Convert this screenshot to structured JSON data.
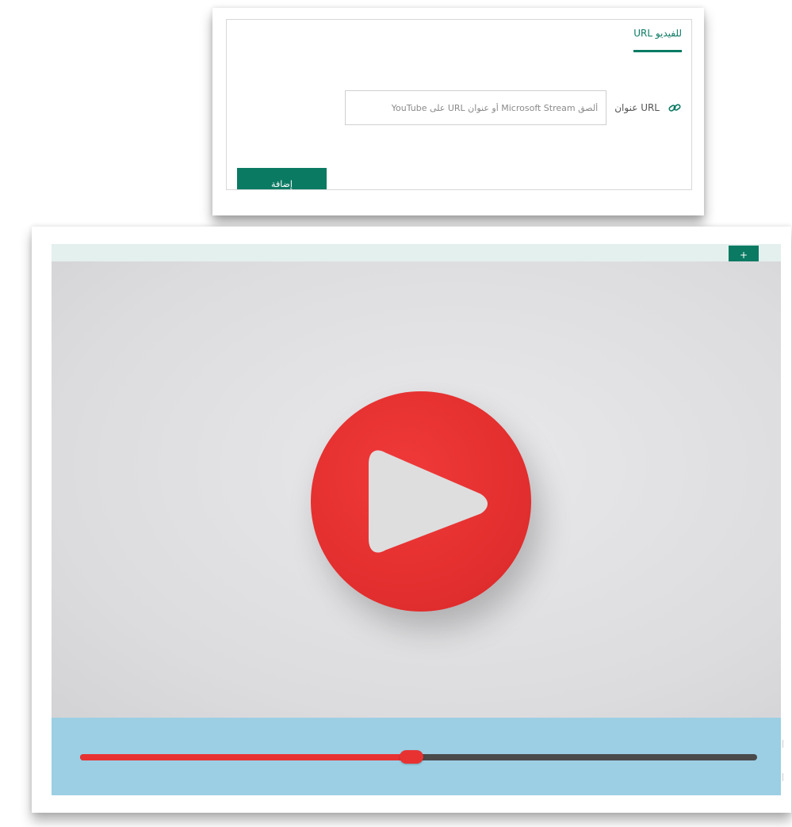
{
  "dialog": {
    "tab_label": "URL للفيديو",
    "url_label": "عنوان URL",
    "url_input_value": "",
    "url_input_placeholder": "ألصق Microsoft Stream أو عنوان URL على YouTube",
    "add_button_label": "إضافة",
    "link_icon": "link-icon",
    "accent_color": "#0b7a63"
  },
  "preview": {
    "corner_button_label": "+",
    "play_icon": "play-icon",
    "play_button_color": "#e53030",
    "controls_background": "#9ccfe4",
    "progress": 0.49,
    "progress_fill_color": "#e83232",
    "track_color": "#4a4a4a"
  }
}
